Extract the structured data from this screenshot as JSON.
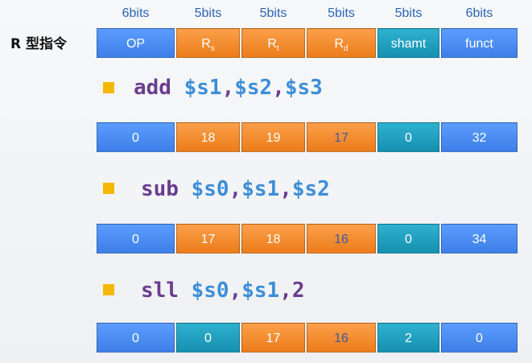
{
  "header": {
    "bits": [
      "6bits",
      "5bits",
      "5bits",
      "5bits",
      "5bits",
      "6bits"
    ],
    "label": "R 型指令",
    "fields": [
      {
        "text": "OP",
        "sub": "",
        "color": "blue"
      },
      {
        "text": "R",
        "sub": "s",
        "color": "orange"
      },
      {
        "text": "R",
        "sub": "t",
        "color": "orange"
      },
      {
        "text": "R",
        "sub": "d",
        "color": "orange"
      },
      {
        "text": "shamt",
        "sub": "",
        "color": "teal"
      },
      {
        "text": "funct",
        "sub": "",
        "color": "blue"
      }
    ]
  },
  "instructions": [
    {
      "op": "add",
      "arg1": "$s1",
      "sep1": ",",
      "arg2": "$s2",
      "sep2": ",",
      "arg3": "$s3",
      "fields": [
        {
          "value": "0",
          "color": "blue"
        },
        {
          "value": "18",
          "color": "orange"
        },
        {
          "value": "19",
          "color": "orange"
        },
        {
          "value": "17",
          "color": "orange"
        },
        {
          "value": "0",
          "color": "teal"
        },
        {
          "value": "32",
          "color": "blue"
        }
      ]
    },
    {
      "op": "sub",
      "arg1": "$s0",
      "sep1": ",",
      "arg2": "$s1",
      "sep2": ",",
      "arg3": "$s2",
      "fields": [
        {
          "value": "0",
          "color": "blue"
        },
        {
          "value": "17",
          "color": "orange"
        },
        {
          "value": "18",
          "color": "orange"
        },
        {
          "value": "16",
          "color": "orange"
        },
        {
          "value": "0",
          "color": "teal"
        },
        {
          "value": "34",
          "color": "blue"
        }
      ]
    },
    {
      "op": "sll",
      "arg1": "$s0",
      "sep1": ",",
      "arg2": "$s1",
      "sep2": ",",
      "arg3": "2",
      "fields": [
        {
          "value": "0",
          "color": "blue"
        },
        {
          "value": "0",
          "color": "teal"
        },
        {
          "value": "17",
          "color": "orange"
        },
        {
          "value": "16",
          "color": "orange"
        },
        {
          "value": "2",
          "color": "teal"
        },
        {
          "value": "0",
          "color": "blue"
        }
      ]
    }
  ],
  "colors": {
    "blue": "#4a8cf5",
    "orange": "#f58a2a",
    "teal": "#1fa2c2",
    "bullet": "#f5b800",
    "opcode": "#6a3d8f",
    "register": "#3c8ed8"
  }
}
